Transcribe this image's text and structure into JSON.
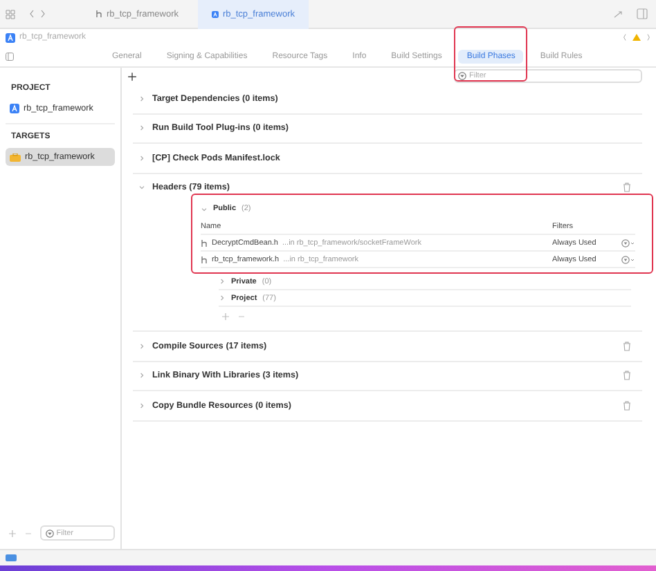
{
  "editor_tabs": [
    {
      "label": "rb_tcp_framework",
      "kind": "header",
      "selected": false
    },
    {
      "label": "rb_tcp_framework",
      "kind": "project",
      "selected": true
    }
  ],
  "breadcrumb": "rb_tcp_framework",
  "settings_tabs": [
    {
      "label": "General",
      "selected": false,
      "highlighted": false
    },
    {
      "label": "Signing & Capabilities",
      "selected": false,
      "highlighted": false
    },
    {
      "label": "Resource Tags",
      "selected": false,
      "highlighted": false
    },
    {
      "label": "Info",
      "selected": false,
      "highlighted": false
    },
    {
      "label": "Build Settings",
      "selected": false,
      "highlighted": false
    },
    {
      "label": "Build Phases",
      "selected": true,
      "highlighted": true
    },
    {
      "label": "Build Rules",
      "selected": false,
      "highlighted": false
    }
  ],
  "phase_filter": {
    "placeholder": "Filter"
  },
  "sidebar": {
    "sections": [
      {
        "title": "PROJECT",
        "items": [
          {
            "label": "rb_tcp_framework",
            "kind": "project",
            "selected": false
          }
        ]
      },
      {
        "title": "TARGETS",
        "items": [
          {
            "label": "rb_tcp_framework",
            "kind": "target",
            "selected": true
          }
        ]
      }
    ],
    "filter": {
      "placeholder": "Filter"
    }
  },
  "phases": [
    {
      "title": "Target Dependencies (0 items)",
      "expanded": false,
      "deletable": false
    },
    {
      "title": "Run Build Tool Plug-ins (0 items)",
      "expanded": false,
      "deletable": false
    },
    {
      "title": "[CP] Check Pods Manifest.lock",
      "expanded": false,
      "deletable": false
    },
    {
      "title": "Headers (79 items)",
      "expanded": true,
      "deletable": true,
      "groups": [
        {
          "name": "Public",
          "count": "(2)",
          "expanded": true,
          "highlighted": true,
          "columns": [
            "Name",
            "Filters"
          ],
          "files": [
            {
              "name": "DecryptCmdBean.h",
              "path": "...in rb_tcp_framework/socketFrameWork",
              "filter": "Always Used"
            },
            {
              "name": "rb_tcp_framework.h",
              "path": "...in rb_tcp_framework",
              "filter": "Always Used"
            }
          ]
        },
        {
          "name": "Private",
          "count": "(0)",
          "expanded": false
        },
        {
          "name": "Project",
          "count": "(77)",
          "expanded": false
        }
      ]
    },
    {
      "title": "Compile Sources (17 items)",
      "expanded": false,
      "deletable": true
    },
    {
      "title": "Link Binary With Libraries (3 items)",
      "expanded": false,
      "deletable": true
    },
    {
      "title": "Copy Bundle Resources (0 items)",
      "expanded": false,
      "deletable": true
    }
  ]
}
